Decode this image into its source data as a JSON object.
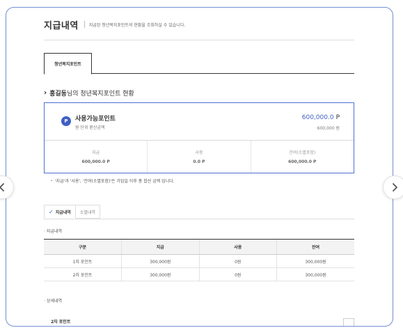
{
  "header": {
    "title": "지급내역",
    "description": "지급된 청년복지포인트의 현황을 조회하실 수 있습니다."
  },
  "tabs": [
    {
      "label": "청년복지포인트",
      "active": true
    }
  ],
  "status": {
    "user_name": "홍길동",
    "suffix": "님의 청년복지포인트 현황"
  },
  "summary": {
    "badge": "P",
    "available_label": "사용가능포인트",
    "available_sub": "원 단위 환산금액",
    "available_value": "600,000.0",
    "available_unit": "P",
    "available_won": "600,000 원",
    "stats": [
      {
        "label": "지급",
        "value": "600,000.0 P"
      },
      {
        "label": "사용",
        "value": "0.0 P"
      },
      {
        "label": "잔여(소멸포함)",
        "value": "600,000.0 P"
      }
    ]
  },
  "note": "・ '지급'과 '사용', '잔여(소멸포함)'은 가입일 이후 총 합산 금액 입니다.",
  "sub_tabs": [
    {
      "label": "지급내역",
      "active": true
    },
    {
      "label": "소멸내역",
      "active": false
    }
  ],
  "section_payment": "지급내역",
  "table": {
    "headers": [
      "구분",
      "지급",
      "사용",
      "잔여"
    ],
    "rows": [
      [
        "1차 포인트",
        "300,000원",
        "0원",
        "300,000원"
      ],
      [
        "2차 포인트",
        "300,000원",
        "0원",
        "300,000원"
      ]
    ]
  },
  "section_detail": "상세내역",
  "detail_title": "2차 포인트",
  "colors": {
    "accent": "#3e5fc4",
    "frame_border": "#6f8fd2"
  },
  "icons": {
    "prev": "chevron-left-icon",
    "next": "chevron-right-icon",
    "heading": "chevron-right-icon",
    "active_sub_tab": "check-icon"
  }
}
